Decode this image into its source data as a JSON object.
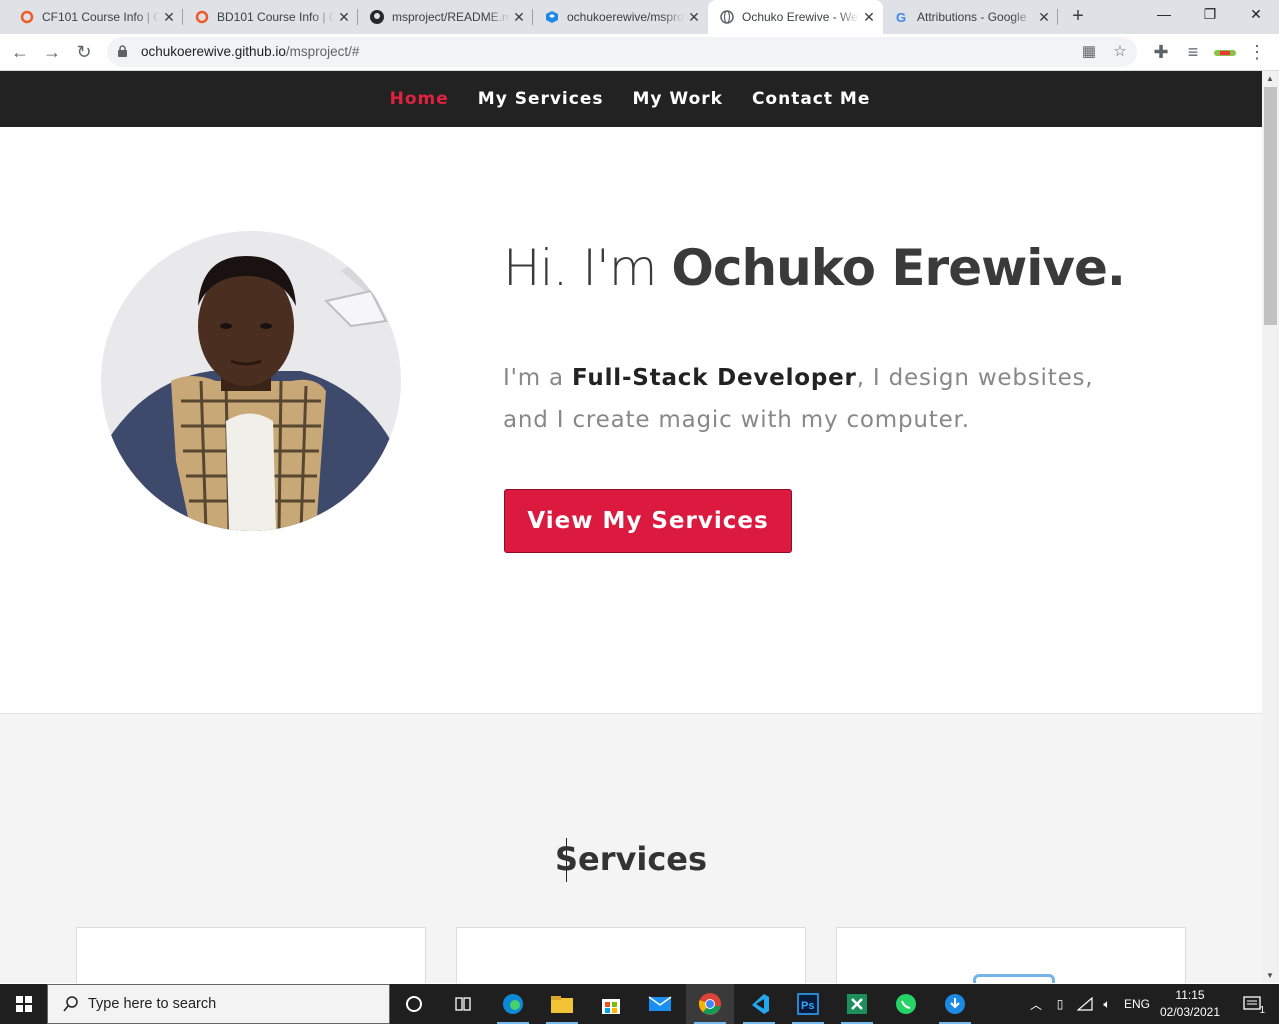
{
  "browser": {
    "tabs": [
      {
        "title": "CF101 Course Info | C",
        "icon": "orange-ring-icon"
      },
      {
        "title": "BD101 Course Info | C",
        "icon": "orange-ring-icon"
      },
      {
        "title": "msproject/README.md",
        "icon": "github-icon"
      },
      {
        "title": "ochukoerewive/msproject",
        "icon": "codesandbox-icon"
      },
      {
        "title": "Ochuko Erewive - Web",
        "icon": "globe-icon",
        "active": true
      },
      {
        "title": "Attributions - Google",
        "icon": "google-icon"
      }
    ],
    "url_host": "ochukoerewive.github.io",
    "url_path": "/msproject/#"
  },
  "page": {
    "nav": [
      "Home",
      "My Services",
      "My Work",
      "Contact Me"
    ],
    "hero": {
      "greeting": "Hi. I'm ",
      "name": "Ochuko Erewive.",
      "tagline_pre": "I'm a ",
      "tagline_role": "Full-Stack Developer",
      "tagline_post": ", I design websites, and I create magic with my computer.",
      "cta": "View My Services"
    },
    "services": {
      "heading": "Services"
    }
  },
  "taskbar": {
    "search_placeholder": "Type here to search",
    "language": "ENG",
    "time": "11:15",
    "date": "02/03/2021",
    "notifications": "1"
  },
  "colors": {
    "accent": "#dc1a40",
    "nav_bg": "#222222",
    "nav_active": "#e0223f"
  }
}
